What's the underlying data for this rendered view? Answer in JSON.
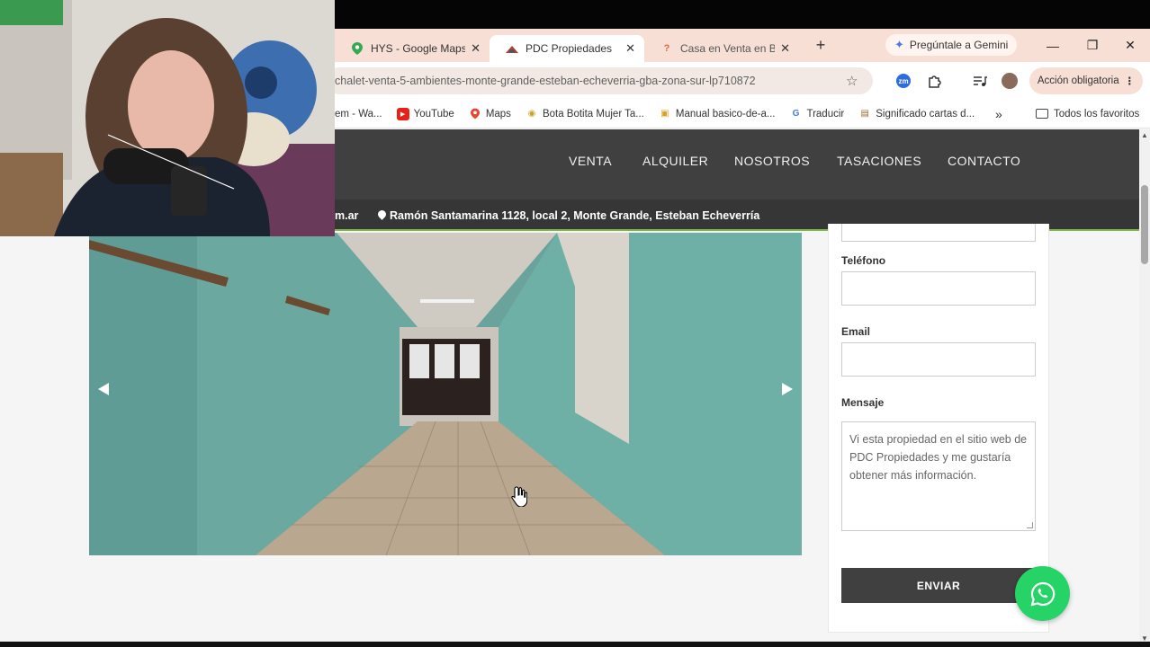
{
  "browser": {
    "tabs": [
      {
        "title": "HYS - Google Maps",
        "icon": "google-maps-icon",
        "active": false
      },
      {
        "title": "PDC Propiedades",
        "icon": "pdc-icon",
        "active": true
      },
      {
        "title": "Casa en Venta en Ban",
        "icon": "question-icon",
        "active": false
      }
    ],
    "gemini_label": "Pregúntale a Gemini",
    "url": "chalet-venta-5-ambientes-monte-grande-esteban-echeverria-gba-zona-sur-lp710872",
    "accion_label": "Acción obligatoria",
    "zm_label": "zm",
    "bookmarks": [
      "em - Wa...",
      "YouTube",
      "Maps",
      "Bota Botita Mujer Ta...",
      "Manual basico-de-a...",
      "Traducir",
      "Significado cartas d..."
    ],
    "all_bookmarks": "Todos los favoritos"
  },
  "site": {
    "nav": [
      "VENTA",
      "ALQUILER",
      "NOSOTROS",
      "TASACIONES",
      "CONTACTO"
    ],
    "email_tail": "m.ar",
    "address": "Ramón Santamarina 1128, local 2, Monte Grande, Esteban Echeverría"
  },
  "form": {
    "phone_label": "Teléfono",
    "email_label": "Email",
    "message_label": "Mensaje",
    "message_value": "Vi esta propiedad en el sitio web de PDC Propiedades y me gustaría obtener más información.",
    "send_label": "ENVIAR"
  },
  "colors": {
    "nav_bg": "#404040",
    "accent_green": "#7fb84a",
    "whatsapp": "#25d366",
    "tab_bar": "#f7dfd5"
  }
}
